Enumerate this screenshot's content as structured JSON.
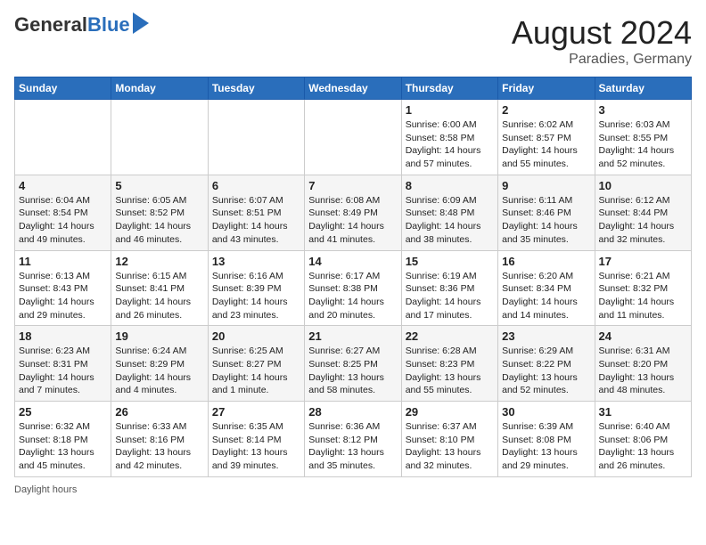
{
  "header": {
    "logo_general": "General",
    "logo_blue": "Blue",
    "month": "August 2024",
    "location": "Paradies, Germany"
  },
  "days_of_week": [
    "Sunday",
    "Monday",
    "Tuesday",
    "Wednesday",
    "Thursday",
    "Friday",
    "Saturday"
  ],
  "weeks": [
    [
      {
        "num": "",
        "info": ""
      },
      {
        "num": "",
        "info": ""
      },
      {
        "num": "",
        "info": ""
      },
      {
        "num": "",
        "info": ""
      },
      {
        "num": "1",
        "info": "Sunrise: 6:00 AM\nSunset: 8:58 PM\nDaylight: 14 hours and 57 minutes."
      },
      {
        "num": "2",
        "info": "Sunrise: 6:02 AM\nSunset: 8:57 PM\nDaylight: 14 hours and 55 minutes."
      },
      {
        "num": "3",
        "info": "Sunrise: 6:03 AM\nSunset: 8:55 PM\nDaylight: 14 hours and 52 minutes."
      }
    ],
    [
      {
        "num": "4",
        "info": "Sunrise: 6:04 AM\nSunset: 8:54 PM\nDaylight: 14 hours and 49 minutes."
      },
      {
        "num": "5",
        "info": "Sunrise: 6:05 AM\nSunset: 8:52 PM\nDaylight: 14 hours and 46 minutes."
      },
      {
        "num": "6",
        "info": "Sunrise: 6:07 AM\nSunset: 8:51 PM\nDaylight: 14 hours and 43 minutes."
      },
      {
        "num": "7",
        "info": "Sunrise: 6:08 AM\nSunset: 8:49 PM\nDaylight: 14 hours and 41 minutes."
      },
      {
        "num": "8",
        "info": "Sunrise: 6:09 AM\nSunset: 8:48 PM\nDaylight: 14 hours and 38 minutes."
      },
      {
        "num": "9",
        "info": "Sunrise: 6:11 AM\nSunset: 8:46 PM\nDaylight: 14 hours and 35 minutes."
      },
      {
        "num": "10",
        "info": "Sunrise: 6:12 AM\nSunset: 8:44 PM\nDaylight: 14 hours and 32 minutes."
      }
    ],
    [
      {
        "num": "11",
        "info": "Sunrise: 6:13 AM\nSunset: 8:43 PM\nDaylight: 14 hours and 29 minutes."
      },
      {
        "num": "12",
        "info": "Sunrise: 6:15 AM\nSunset: 8:41 PM\nDaylight: 14 hours and 26 minutes."
      },
      {
        "num": "13",
        "info": "Sunrise: 6:16 AM\nSunset: 8:39 PM\nDaylight: 14 hours and 23 minutes."
      },
      {
        "num": "14",
        "info": "Sunrise: 6:17 AM\nSunset: 8:38 PM\nDaylight: 14 hours and 20 minutes."
      },
      {
        "num": "15",
        "info": "Sunrise: 6:19 AM\nSunset: 8:36 PM\nDaylight: 14 hours and 17 minutes."
      },
      {
        "num": "16",
        "info": "Sunrise: 6:20 AM\nSunset: 8:34 PM\nDaylight: 14 hours and 14 minutes."
      },
      {
        "num": "17",
        "info": "Sunrise: 6:21 AM\nSunset: 8:32 PM\nDaylight: 14 hours and 11 minutes."
      }
    ],
    [
      {
        "num": "18",
        "info": "Sunrise: 6:23 AM\nSunset: 8:31 PM\nDaylight: 14 hours and 7 minutes."
      },
      {
        "num": "19",
        "info": "Sunrise: 6:24 AM\nSunset: 8:29 PM\nDaylight: 14 hours and 4 minutes."
      },
      {
        "num": "20",
        "info": "Sunrise: 6:25 AM\nSunset: 8:27 PM\nDaylight: 14 hours and 1 minute."
      },
      {
        "num": "21",
        "info": "Sunrise: 6:27 AM\nSunset: 8:25 PM\nDaylight: 13 hours and 58 minutes."
      },
      {
        "num": "22",
        "info": "Sunrise: 6:28 AM\nSunset: 8:23 PM\nDaylight: 13 hours and 55 minutes."
      },
      {
        "num": "23",
        "info": "Sunrise: 6:29 AM\nSunset: 8:22 PM\nDaylight: 13 hours and 52 minutes."
      },
      {
        "num": "24",
        "info": "Sunrise: 6:31 AM\nSunset: 8:20 PM\nDaylight: 13 hours and 48 minutes."
      }
    ],
    [
      {
        "num": "25",
        "info": "Sunrise: 6:32 AM\nSunset: 8:18 PM\nDaylight: 13 hours and 45 minutes."
      },
      {
        "num": "26",
        "info": "Sunrise: 6:33 AM\nSunset: 8:16 PM\nDaylight: 13 hours and 42 minutes."
      },
      {
        "num": "27",
        "info": "Sunrise: 6:35 AM\nSunset: 8:14 PM\nDaylight: 13 hours and 39 minutes."
      },
      {
        "num": "28",
        "info": "Sunrise: 6:36 AM\nSunset: 8:12 PM\nDaylight: 13 hours and 35 minutes."
      },
      {
        "num": "29",
        "info": "Sunrise: 6:37 AM\nSunset: 8:10 PM\nDaylight: 13 hours and 32 minutes."
      },
      {
        "num": "30",
        "info": "Sunrise: 6:39 AM\nSunset: 8:08 PM\nDaylight: 13 hours and 29 minutes."
      },
      {
        "num": "31",
        "info": "Sunrise: 6:40 AM\nSunset: 8:06 PM\nDaylight: 13 hours and 26 minutes."
      }
    ]
  ],
  "legend": "Daylight hours"
}
